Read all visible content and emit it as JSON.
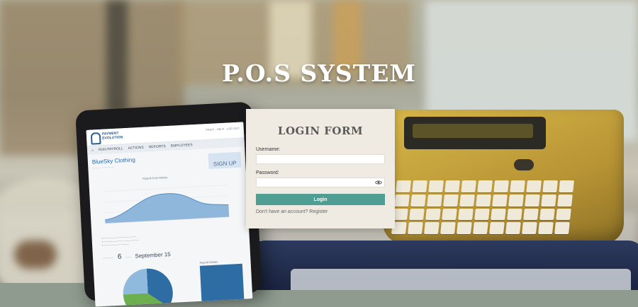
{
  "page": {
    "title": "P.O.S SYSTEM"
  },
  "login_form": {
    "heading": "LOGIN FORM",
    "username_label": "Username:",
    "username_value": "",
    "password_label": "Password:",
    "password_value": "",
    "submit_label": "Login",
    "register_prompt": "Don't have an account?",
    "register_link": "Register"
  },
  "tablet_screen": {
    "brand": [
      "PAYMENT",
      "EVOLUTION"
    ],
    "top_links": "PRINT · HELP · LOG OUT",
    "nav": [
      "RUN PAYROLL",
      "ACTIONS",
      "REPORTS",
      "EMPLOYEES"
    ],
    "company": "BlueSky Clothing",
    "signup": "SIGN UP",
    "chart_title": "Payroll Cost History",
    "stats_value": "6",
    "stats_date": "September 15",
    "panel_title": "Payroll Details"
  },
  "colors": {
    "accent": "#4f9e93",
    "card_background": "#efebe2"
  },
  "icons": {
    "password_toggle": "eye-icon"
  }
}
